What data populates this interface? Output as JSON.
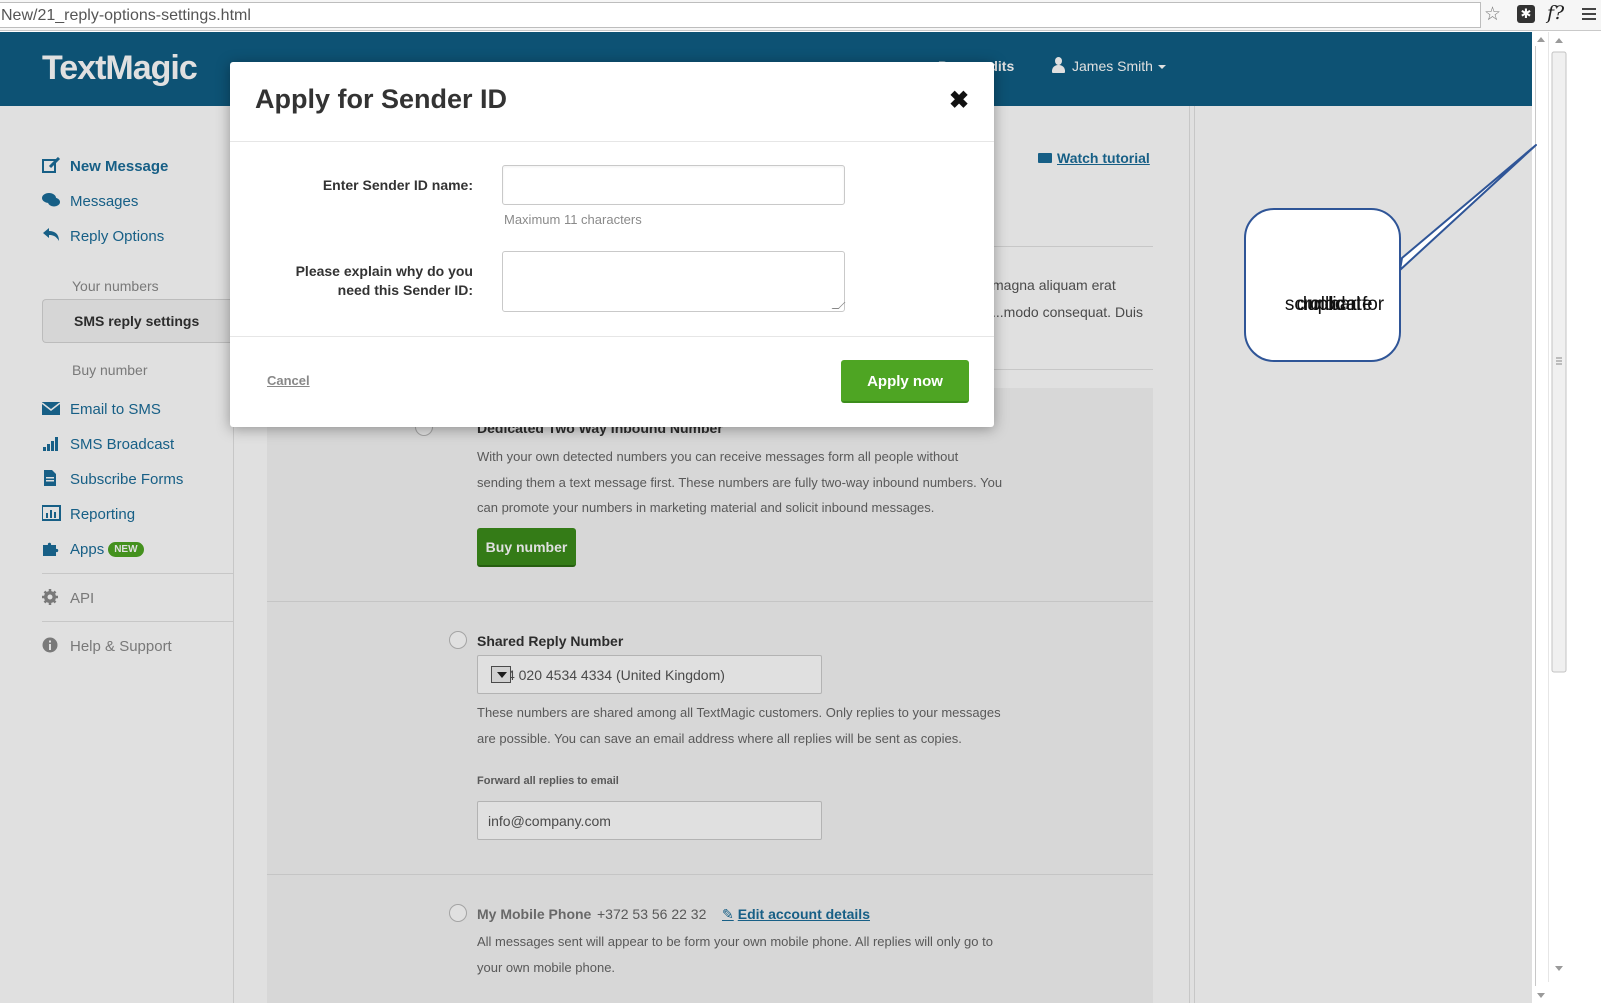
{
  "browser": {
    "url": "New/21_reply-options-settings.html",
    "star_glyph": "☆",
    "ext1_glyph": "✱",
    "ext2_glyph": "f?"
  },
  "header": {
    "logo": "TextMagic",
    "credits": "Buy credits",
    "user": "James Smith"
  },
  "sidebar": {
    "new_message": "New Message",
    "messages": "Messages",
    "reply_options": "Reply Options",
    "your_numbers": "Your numbers",
    "sms_reply_settings": "SMS reply settings",
    "buy_number": "Buy number",
    "email_to_sms": "Email to SMS",
    "sms_broadcast": "SMS Broadcast",
    "subscribe_forms": "Subscribe Forms",
    "reporting": "Reporting",
    "apps": "Apps",
    "apps_badge": "NEW",
    "api": "API",
    "help": "Help & Support"
  },
  "main": {
    "watch_tutorial": "Watch tutorial",
    "intro": "magna aliquam erat ...modo consequat. Duis",
    "dedicated": {
      "title": "Dedicated Two Way Inbound Number",
      "text": "With your own detected numbers you can receive messages form all people without sending them a text message first. These numbers are fully two-way inbound numbers. You can promote your numbers in marketing material and solicit inbound messages.",
      "buy_button": "Buy number"
    },
    "shared": {
      "title": "Shared Reply Number",
      "selected": "+44 020 4534 4334 (United Kingdom)",
      "text": "These numbers are shared among all TextMagic customers. Only replies to your messages are possible. You can save an email address where all replies will be sent as copies.",
      "forward_label": "Forward all replies to email",
      "email": "info@company.com"
    },
    "mobile": {
      "title": "My Mobile Phone",
      "phone": "+372 53 56 22 32",
      "edit_link": "Edit account details",
      "text": "All messages sent will appear to be form your own mobile phone. All replies will only go to your own mobile phone."
    }
  },
  "modal": {
    "title": "Apply for Sender ID",
    "close_glyph": "✖",
    "sender_label": "Enter Sender ID name:",
    "sender_value": "",
    "sender_hint": "Maximum 11 characters",
    "reason_label_line1": "Please explain why do you",
    "reason_label_line2": "need this Sender ID:",
    "reason_value": "",
    "cancel": "Cancel",
    "apply": "Apply now"
  },
  "annotation": {
    "line1": "duplicate",
    "line2": "scrollbar for",
    "line3": "modal"
  },
  "colors": {
    "brand_blue": "#0f5e84",
    "link_blue": "#1b6d99",
    "green": "#4ea523",
    "callout_border": "#2f5597"
  }
}
